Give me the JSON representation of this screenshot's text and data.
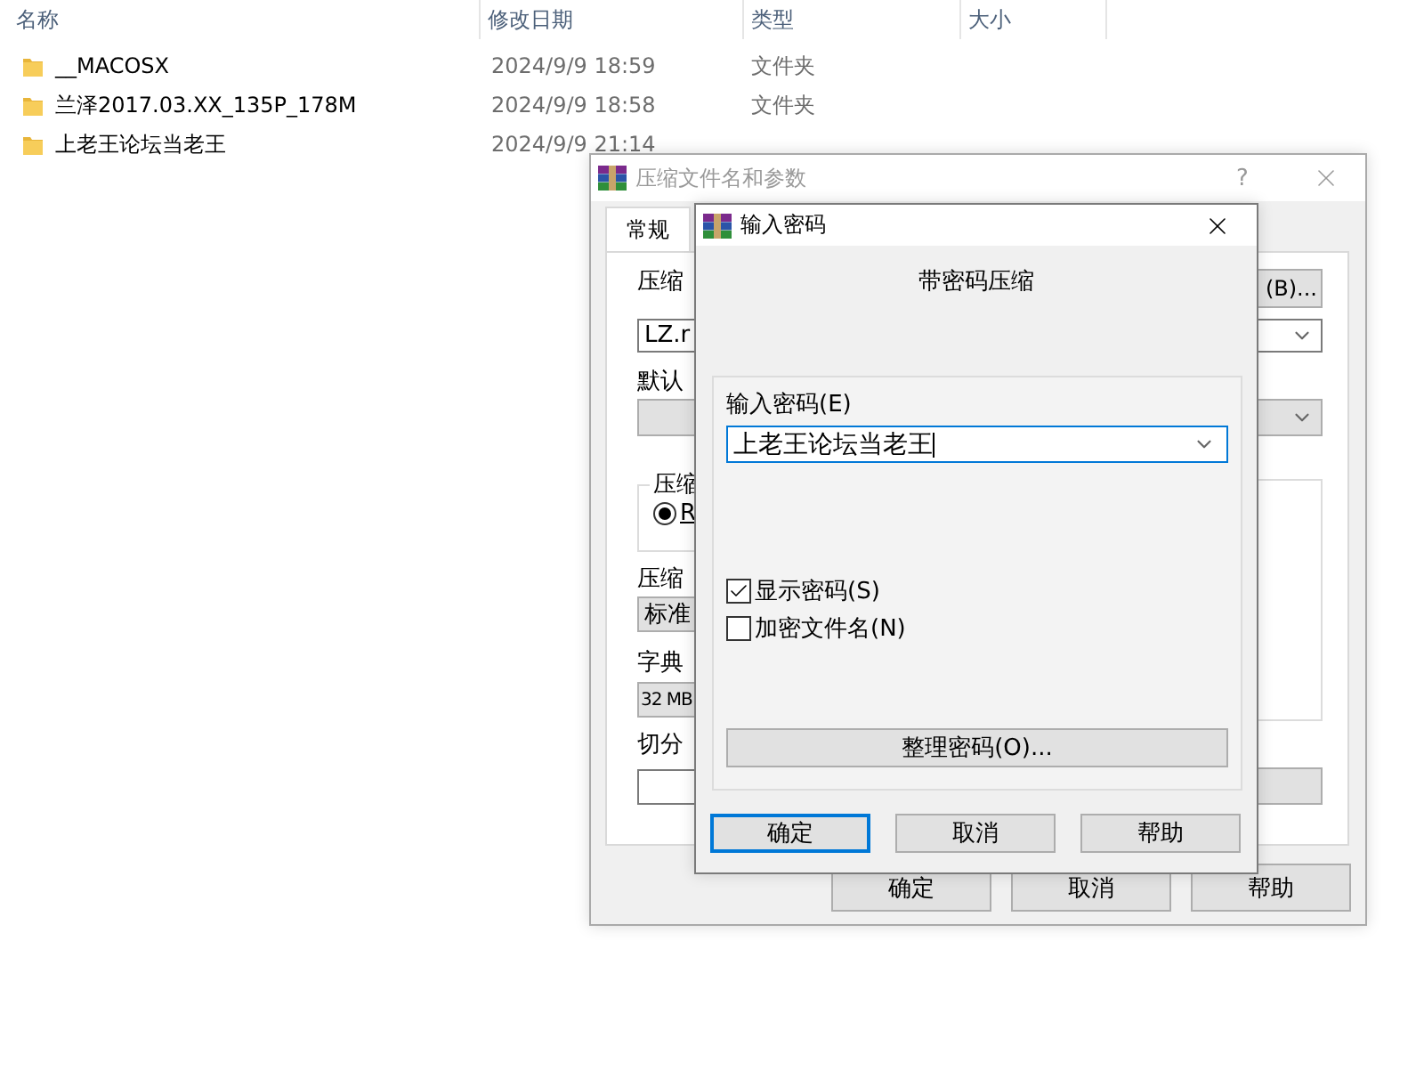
{
  "explorer": {
    "columns": [
      "名称",
      "修改日期",
      "类型",
      "大小"
    ],
    "rows": [
      {
        "name": "__MACOSX",
        "modified": "2024/9/9 18:59",
        "type": "文件夹"
      },
      {
        "name": "兰泽2017.03.XX_135P_178M",
        "modified": "2024/9/9 18:58",
        "type": "文件夹"
      },
      {
        "name": "上老王论坛当老王",
        "modified": "2024/9/9 21:14"
      }
    ]
  },
  "archive_dialog": {
    "title": "压缩文件名和参数",
    "help": "?",
    "tabs": [
      {
        "label": "常规",
        "selected": true
      }
    ],
    "name_label": "压缩",
    "browse_button": "(B)...",
    "archive_name": "LZ.r",
    "profile_label": "默认",
    "format_group": "压缩",
    "format_radio": {
      "label": "R",
      "selected": true
    },
    "method_label": "压缩",
    "method": "标准",
    "dictionary_label": "字典",
    "dictionary": "32 MB",
    "split_label": "切分",
    "buttons": [
      "确定",
      "取消",
      "帮助"
    ]
  },
  "password_dialog": {
    "title": "输入密码",
    "heading": "带密码压缩",
    "password_label": "输入密码(E)",
    "password": "上老王论坛当老王",
    "options": [
      {
        "label": "显示密码(S)",
        "checked": true
      },
      {
        "label": "加密文件名(N)",
        "checked": false
      }
    ],
    "organize_button": "整理密码(O)...",
    "buttons": [
      {
        "label": "确定",
        "default": true
      },
      {
        "label": "取消",
        "default": false
      },
      {
        "label": "帮助",
        "default": false
      }
    ]
  }
}
